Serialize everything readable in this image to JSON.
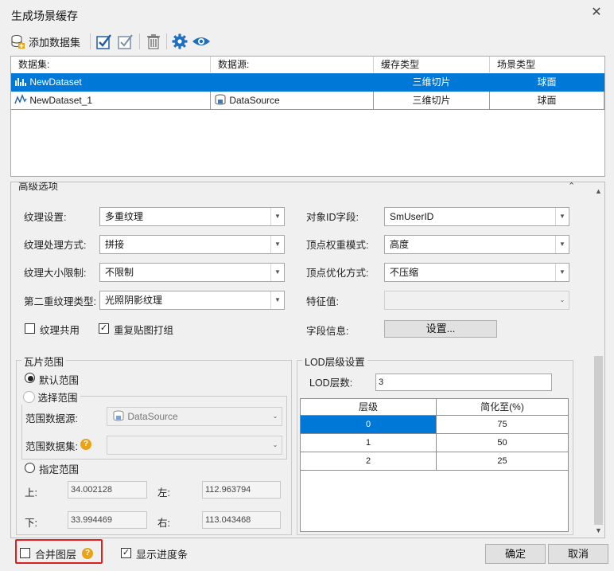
{
  "window": {
    "title": "生成场景缓存"
  },
  "toolbar": {
    "add_dataset_label": "添加数据集"
  },
  "grid": {
    "headers": [
      "数据集:",
      "数据源:",
      "缓存类型",
      "场景类型"
    ],
    "rows": [
      {
        "dataset": "NewDataset",
        "datasource": "",
        "cache_type": "三维切片",
        "scene_type": "球面",
        "selected": true
      },
      {
        "dataset": "NewDataset_1",
        "datasource": "DataSource",
        "cache_type": "三维切片",
        "scene_type": "球面",
        "selected": false
      }
    ]
  },
  "advanced": {
    "title": "高级选项",
    "texture_setting": {
      "label": "纹理设置:",
      "value": "多重纹理"
    },
    "texture_mode": {
      "label": "纹理处理方式:",
      "value": "拼接"
    },
    "texture_size": {
      "label": "纹理大小限制:",
      "value": "不限制"
    },
    "second_texture": {
      "label": "第二重纹理类型:",
      "value": "光照阴影纹理"
    },
    "texture_share": {
      "label": "纹理共用",
      "checked": false
    },
    "repack": {
      "label": "重复贴图打组",
      "checked": true
    },
    "object_id": {
      "label": "对象ID字段:",
      "value": "SmUserID"
    },
    "vertex_weight": {
      "label": "顶点权重模式:",
      "value": "高度"
    },
    "vertex_opt": {
      "label": "顶点优化方式:",
      "value": "不压缩"
    },
    "feature_value": {
      "label": "特征值:",
      "value": ""
    },
    "field_info": {
      "label": "字段信息:",
      "button": "设置..."
    }
  },
  "tile_range": {
    "title": "瓦片范围",
    "default_range": "默认范围",
    "select_range": "选择范围",
    "range_datasource_label": "范围数据源:",
    "range_datasource_value": "DataSource",
    "range_dataset_label": "范围数据集:",
    "specify_range": "指定范围",
    "top_label": "上:",
    "top_value": "34.002128",
    "left_label": "左:",
    "left_value": "112.963794",
    "bottom_label": "下:",
    "bottom_value": "33.994469",
    "right_label": "右:",
    "right_value": "113.043468"
  },
  "lod": {
    "title": "LOD层级设置",
    "count_label": "LOD层数:",
    "count_value": "3",
    "headers": [
      "层级",
      "简化至(%)"
    ],
    "rows": [
      [
        "0",
        "75"
      ],
      [
        "1",
        "50"
      ],
      [
        "2",
        "25"
      ]
    ]
  },
  "footer": {
    "merge_layers": "合并图层",
    "show_progress": "显示进度条",
    "ok": "确定",
    "cancel": "取消"
  },
  "colors": {
    "selection": "#0078d7",
    "highlight_border": "#e02020",
    "help_badge": "#e8a317"
  }
}
